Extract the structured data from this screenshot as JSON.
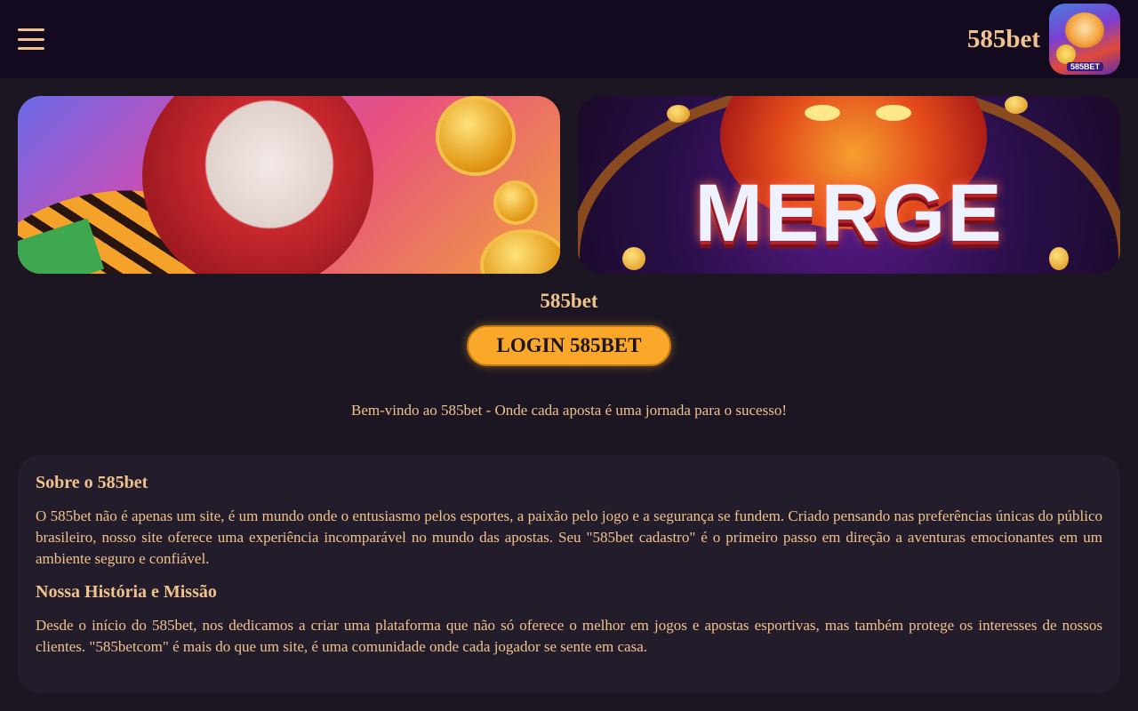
{
  "header": {
    "brand_name": "585bet",
    "logo_tag": "585BET"
  },
  "banners": {
    "banner_2_title": "MERGE"
  },
  "main": {
    "site_title": "585bet",
    "login_label": "LOGIN 585BET",
    "welcome_text": "Bem-vindo ao 585bet - Onde cada aposta é uma jornada para o sucesso!"
  },
  "content": {
    "about_heading": "Sobre o 585bet",
    "about_text": "O 585bet não é apenas um site, é um mundo onde o entusiasmo pelos esportes, a paixão pelo jogo e a segurança se fundem. Criado pensando nas preferências únicas do público brasileiro, nosso site oferece uma experiência incomparável no mundo das apostas. Seu \"585bet cadastro\" é o primeiro passo em direção a aventuras emocionantes em um ambiente seguro e confiável.",
    "history_heading": "Nossa História e Missão",
    "history_text": "Desde o início do 585bet, nos dedicamos a criar uma plataforma que não só oferece o melhor em jogos e apostas esportivas, mas também protege os interesses de nossos clientes. \"585betcom\" é mais do que um site, é uma comunidade onde cada jogador se sente em casa."
  },
  "colors": {
    "header_bg": "#140a20",
    "page_bg": "#1b1622",
    "card_bg": "#231d2b",
    "text_gold": "#f0c38e",
    "button_orange": "#fba82a"
  },
  "icons": {
    "menu": "hamburger-menu-icon"
  }
}
